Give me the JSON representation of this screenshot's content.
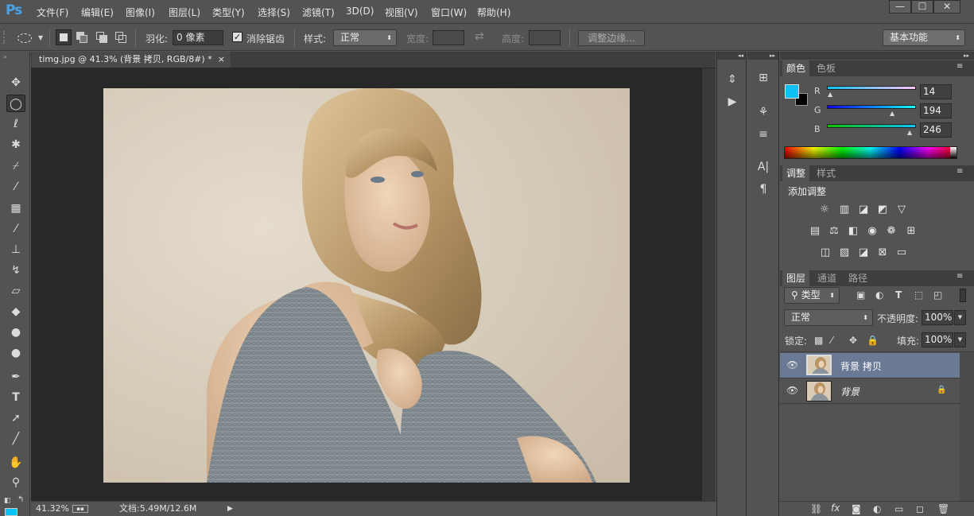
{
  "app": {
    "logo": "Ps"
  },
  "menu": [
    {
      "name": "menu-file",
      "label": "文件(F)"
    },
    {
      "name": "menu-edit",
      "label": "编辑(E)"
    },
    {
      "name": "menu-image",
      "label": "图像(I)"
    },
    {
      "name": "menu-layer",
      "label": "图层(L)"
    },
    {
      "name": "menu-type",
      "label": "类型(Y)"
    },
    {
      "name": "menu-select",
      "label": "选择(S)"
    },
    {
      "name": "menu-filter",
      "label": "滤镜(T)"
    },
    {
      "name": "menu-3d",
      "label": "3D(D)"
    },
    {
      "name": "menu-view",
      "label": "视图(V)"
    },
    {
      "name": "menu-window",
      "label": "窗口(W)"
    },
    {
      "name": "menu-help",
      "label": "帮助(H)"
    }
  ],
  "window_controls": {
    "minimize": "—",
    "maximize": "☐",
    "close": "✕"
  },
  "options": {
    "feather_label": "羽化:",
    "feather_value": "0 像素",
    "antialias_label": "消除锯齿",
    "antialias_checked": true,
    "style_label": "样式:",
    "style_value": "正常",
    "width_label": "宽度:",
    "height_label": "高度:",
    "refine_edge": "调整边缘...",
    "workspace": "基本功能"
  },
  "document": {
    "tab_title": "timg.jpg @ 41.3% (背景 拷贝, RGB/8#) *",
    "close": "×",
    "zoom": "41.32%",
    "doc_size": "文档:5.49M/12.6M"
  },
  "color_panel": {
    "tabs": [
      "颜色",
      "色板"
    ],
    "active_tab": 0,
    "channels": [
      {
        "name": "R",
        "value": "14"
      },
      {
        "name": "G",
        "value": "194"
      },
      {
        "name": "B",
        "value": "246"
      }
    ],
    "foreground": "#0ec2f6",
    "background": "#000000"
  },
  "adjust_panel": {
    "tabs": [
      "调整",
      "样式"
    ],
    "active_tab": 0,
    "title": "添加调整",
    "row1": [
      "brightness-icon",
      "levels-icon",
      "curves-icon",
      "exposure-icon",
      "vibrance-icon"
    ],
    "row2": [
      "hue-saturation-icon",
      "color-balance-icon",
      "black-white-icon",
      "photo-filter-icon",
      "channel-mixer-icon",
      "color-lookup-icon"
    ],
    "row3": [
      "invert-icon",
      "posterize-icon",
      "threshold-icon",
      "selective-color-icon",
      "gradient-map-icon"
    ]
  },
  "layers_panel": {
    "tabs": [
      "图层",
      "通道",
      "路径"
    ],
    "active_tab": 0,
    "filter_label": "类型",
    "blend_mode": "正常",
    "opacity_label": "不透明度:",
    "opacity": "100%",
    "lock_label": "锁定:",
    "fill_label": "填充:",
    "fill": "100%",
    "layers": [
      {
        "name": "背景 拷贝",
        "selected": true,
        "locked": false
      },
      {
        "name": "背景",
        "selected": false,
        "locked": true
      }
    ]
  }
}
